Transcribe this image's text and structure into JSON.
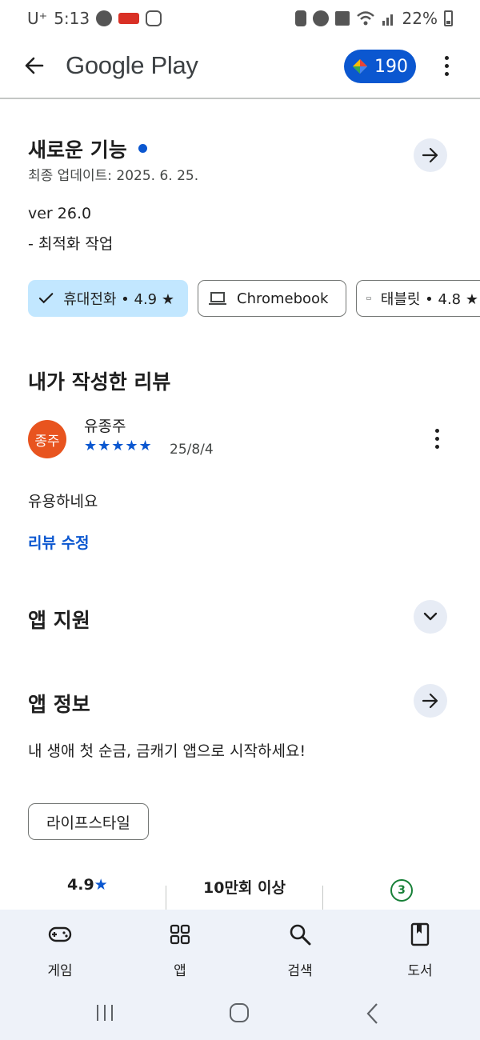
{
  "status_bar": {
    "carrier": "U⁺",
    "time": "5:13",
    "battery": "22%"
  },
  "app_bar": {
    "title": "Google Play",
    "points": "190"
  },
  "whats_new": {
    "title": "새로운 기능",
    "updated": "최종 업데이트: 2025. 6. 25.",
    "version": "ver 26.0",
    "note": "- 최적화 작업"
  },
  "device_chips": [
    {
      "label": "휴대전화 • 4.9 ★",
      "selected": true
    },
    {
      "label": "Chromebook",
      "selected": false
    },
    {
      "label": "태블릿 • 4.8 ★",
      "selected": false
    }
  ],
  "my_review": {
    "title": "내가 작성한 리뷰",
    "avatar_text": "종주",
    "reviewer": "유종주",
    "stars": "★★★★★",
    "rating": 5,
    "date": "25/8/4",
    "text": "유용하네요",
    "edit_label": "리뷰 수정"
  },
  "app_support": {
    "title": "앱 지원"
  },
  "app_info": {
    "title": "앱 정보",
    "description": "내 생애 첫 순금, 금캐기 앱으로 시작하세요!",
    "category": "라이프스타일"
  },
  "stats": {
    "rating": "4.9",
    "rating_star": "★",
    "downloads": "10만회 이상",
    "content_rating": "3"
  },
  "bottom_nav": [
    {
      "label": "게임",
      "icon": "gamepad-icon"
    },
    {
      "label": "앱",
      "icon": "apps-grid-icon"
    },
    {
      "label": "검색",
      "icon": "search-icon"
    },
    {
      "label": "도서",
      "icon": "book-icon"
    }
  ],
  "colors": {
    "accent": "#0b57d0",
    "chip_selected": "#c2e7ff",
    "avatar": "#e8541f",
    "nav_bg": "#eef2f9",
    "content_rating": "#188038"
  }
}
